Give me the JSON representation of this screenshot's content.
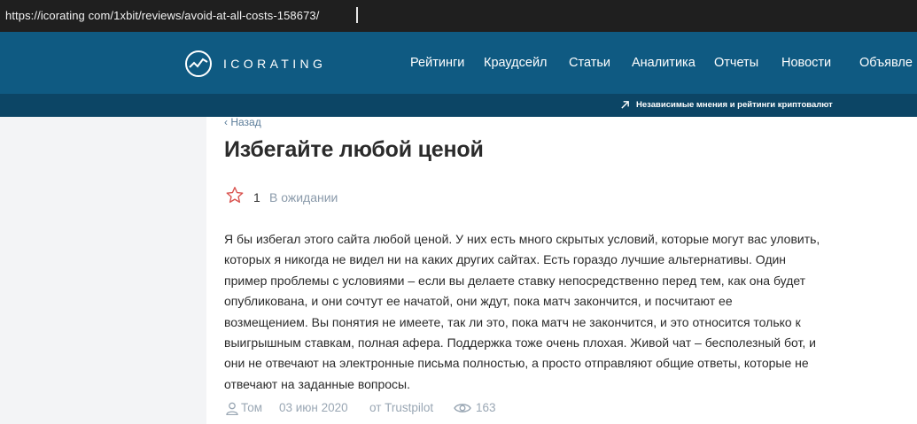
{
  "browser": {
    "url": "https://icorating com/1xbit/reviews/avoid-at-all-costs-158673/"
  },
  "header": {
    "logo_text": "ICORATING",
    "menu": [
      "Рейтинги",
      "Краудсейл",
      "Статьи",
      "Аналитика",
      "Отчеты",
      "Новости",
      "Объявле"
    ],
    "tagline": "Независимые мнения и рейтинги криптовалют"
  },
  "page": {
    "back_label": "Назад",
    "title": "Избегайте любой ценой",
    "rating": "1",
    "status": "В ожидании",
    "review_lines": [
      "Я бы избегал этого сайта любой ценой. У них есть много скрытых условий, которые могут вас уловить,",
      "которых я никогда не видел ни на каких других сайтах. Есть гораздо лучшие альтернативы. Один",
      "пример проблемы с условиями – если вы делаете ставку непосредственно перед тем, как она будет",
      "опубликована, и они сочтут ее начатой, они ждут, пока матч закончится, и посчитают ее",
      "возмещением. Вы понятия не имеете, так ли это, пока матч не закончится, и это относится только к",
      "выигрышным ставкам, полная афера. Поддержка тоже очень плохая. Живой чат – бесполезный бот, и",
      "они не отвечают на электронные письма полностью, а просто отправляют общие ответы, которые не",
      "отвечают на заданные вопросы."
    ],
    "author": "Том",
    "date": "03 июн 2020",
    "source": "от Trustpilot",
    "views": "163"
  },
  "colors": {
    "nav_bg": "#0f5a82",
    "subbar_bg": "#0c4565",
    "star": "#d9534f",
    "muted": "#9aa7b4",
    "link": "#5b7c99"
  }
}
